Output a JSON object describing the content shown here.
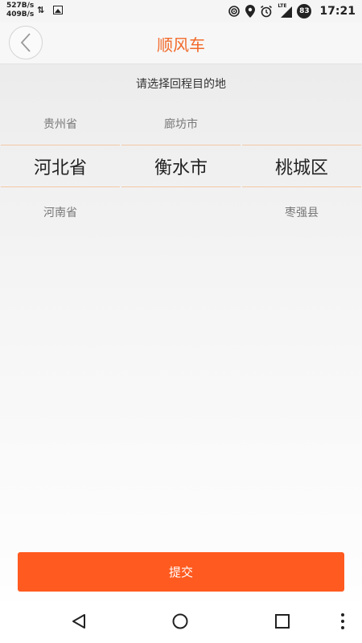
{
  "status_bar": {
    "net_up": "527B/s",
    "net_down": "409B/s",
    "battery": "83",
    "time": "17:21",
    "lte": "LTE"
  },
  "header": {
    "title": "顺风车",
    "back_icon": "chevron-left-icon"
  },
  "prompt": "请选择回程目的地",
  "picker": {
    "columns": [
      {
        "above": "贵州省",
        "selected": "河北省",
        "below": "河南省"
      },
      {
        "above": "廊坊市",
        "selected": "衡水市",
        "below": ""
      },
      {
        "above": "",
        "selected": "桃城区",
        "below": "枣强县"
      }
    ]
  },
  "submit_label": "提交",
  "colors": {
    "accent": "#f26a2a",
    "button": "#ff5a1f",
    "divider": "#f3c8a4"
  },
  "nav_bar": {
    "icons": [
      "back-triangle-icon",
      "home-circle-icon",
      "recents-square-icon",
      "more-vert-icon"
    ]
  }
}
